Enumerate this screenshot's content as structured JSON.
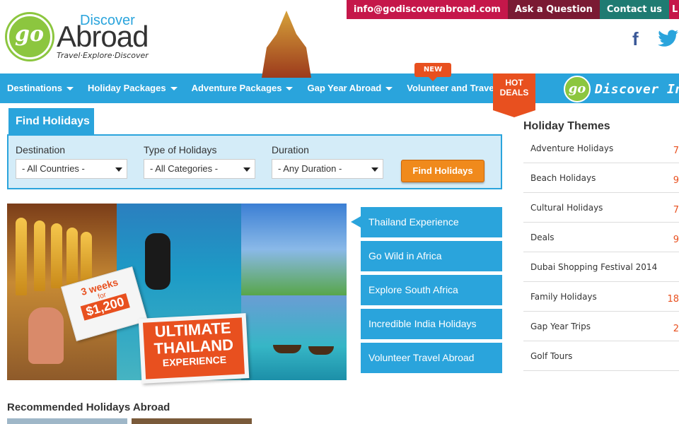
{
  "topbar": {
    "email": "info@godiscoverabroad.com",
    "ask": "Ask a Question",
    "contact": "Contact us",
    "extra": "L"
  },
  "logo": {
    "badge": "go",
    "discover": "Discover",
    "abroad": "Abroad",
    "tagline": "Travel·Explore·Discover"
  },
  "social": {
    "facebook": "f",
    "twitter_icon": "twitter-icon"
  },
  "nav": {
    "items": [
      {
        "label": "Destinations"
      },
      {
        "label": "Holiday Packages"
      },
      {
        "label": "Adventure Packages"
      },
      {
        "label": "Gap Year Abroad"
      },
      {
        "label": "Volunteer and Travel"
      }
    ],
    "new_badge": "NEW",
    "hot_deals_line1": "HOT",
    "hot_deals_line2": "DEALS",
    "discover_india_badge": "go",
    "discover_india": "Discover India"
  },
  "find": {
    "tab": "Find Holidays",
    "destination_label": "Destination",
    "destination_value": "- All Countries -",
    "type_label": "Type of Holidays",
    "type_value": "- All Categories -",
    "duration_label": "Duration",
    "duration_value": "- Any Duration -",
    "button": "Find Holidays"
  },
  "banner": {
    "tag_line1": "3 weeks",
    "tag_line2": "for",
    "tag_price": "$1,200",
    "ultimate1": "ULTIMATE",
    "ultimate2": "THAILAND",
    "ultimate3": "EXPERIENCE"
  },
  "slides": [
    "Thailand Experience",
    "Go Wild in Africa",
    "Explore South Africa",
    "Incredible India Holidays",
    "Volunteer Travel Abroad"
  ],
  "themes": {
    "title": "Holiday Themes",
    "items": [
      {
        "label": "Adventure Holidays",
        "count": "7"
      },
      {
        "label": "Beach Holidays",
        "count": "9"
      },
      {
        "label": "Cultural Holidays",
        "count": "7"
      },
      {
        "label": "Deals",
        "count": "9"
      },
      {
        "label": "Dubai Shopping Festival 2014",
        "count": ""
      },
      {
        "label": "Family Holidays",
        "count": "18"
      },
      {
        "label": "Gap Year Trips",
        "count": "2"
      },
      {
        "label": "Golf Tours",
        "count": ""
      }
    ]
  },
  "recommended": {
    "title": "Recommended Holidays Abroad"
  },
  "colors": {
    "brand_blue": "#2aa4dc",
    "brand_green": "#8cc63f",
    "accent_orange": "#e8501f",
    "button_orange": "#f08a1c",
    "email_red": "#c5174a",
    "ask_maroon": "#7a1a33",
    "contact_teal": "#1f7b72"
  }
}
